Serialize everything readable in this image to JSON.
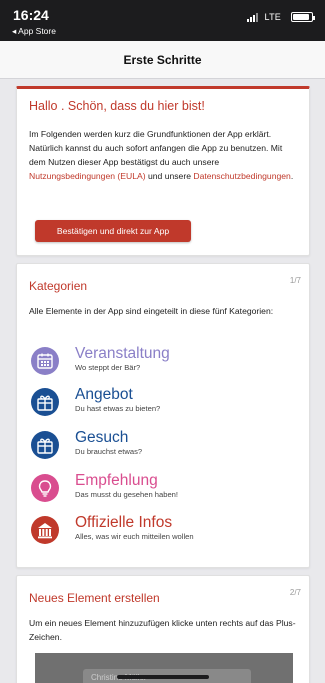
{
  "status": {
    "time": "16:24",
    "back": "◂ App Store",
    "network": "LTE"
  },
  "header": {
    "title": "Erste Schritte"
  },
  "welcome": {
    "title": "Hallo . Schön, dass du hier bist!",
    "text_1": "Im Folgenden werden kurz die Grundfunktionen der App erklärt. Natürlich kannst du auch sofort anfangen die App zu benutzen. Mit dem Nutzen dieser App bestätigst du auch unsere ",
    "link_1": "Nutzungsbedingungen (EULA)",
    "text_2": " und unsere ",
    "link_2": "Datenschutzbedingungen",
    "text_3": ".",
    "button": "Bestätigen und direkt zur App"
  },
  "categories_card": {
    "title": "Kategorien",
    "pager": "1/7",
    "text": "Alle Elemente in der App sind eingeteilt in diese fünf Kategorien:",
    "items": [
      {
        "name": "Veranstaltung",
        "subtitle": "Wo steppt der Bär?",
        "icon": "calendar-icon",
        "color": "#8a7fc7"
      },
      {
        "name": "Angebot",
        "subtitle": "Du hast etwas zu bieten?",
        "icon": "gift-icon",
        "color": "#1a4f93"
      },
      {
        "name": "Gesuch",
        "subtitle": "Du brauchst etwas?",
        "icon": "gift-icon",
        "color": "#1a4f93"
      },
      {
        "name": "Empfehlung",
        "subtitle": "Das musst du gesehen haben!",
        "icon": "lightbulb-icon",
        "color": "#d94d8f"
      },
      {
        "name": "Offizielle Infos",
        "subtitle": "Alles, was wir euch mitteilen wollen",
        "icon": "building-icon",
        "color": "#c0392b"
      }
    ]
  },
  "create_card": {
    "title": "Neues Element erstellen",
    "pager": "2/7",
    "text": "Um ein neues Element hinzuzufügen klicke unten rechts auf das Plus-Zeichen.",
    "preview_text": "Christine Müller"
  },
  "colors": {
    "accent": "#c0392b",
    "statusbar": "#1c1c1e"
  }
}
